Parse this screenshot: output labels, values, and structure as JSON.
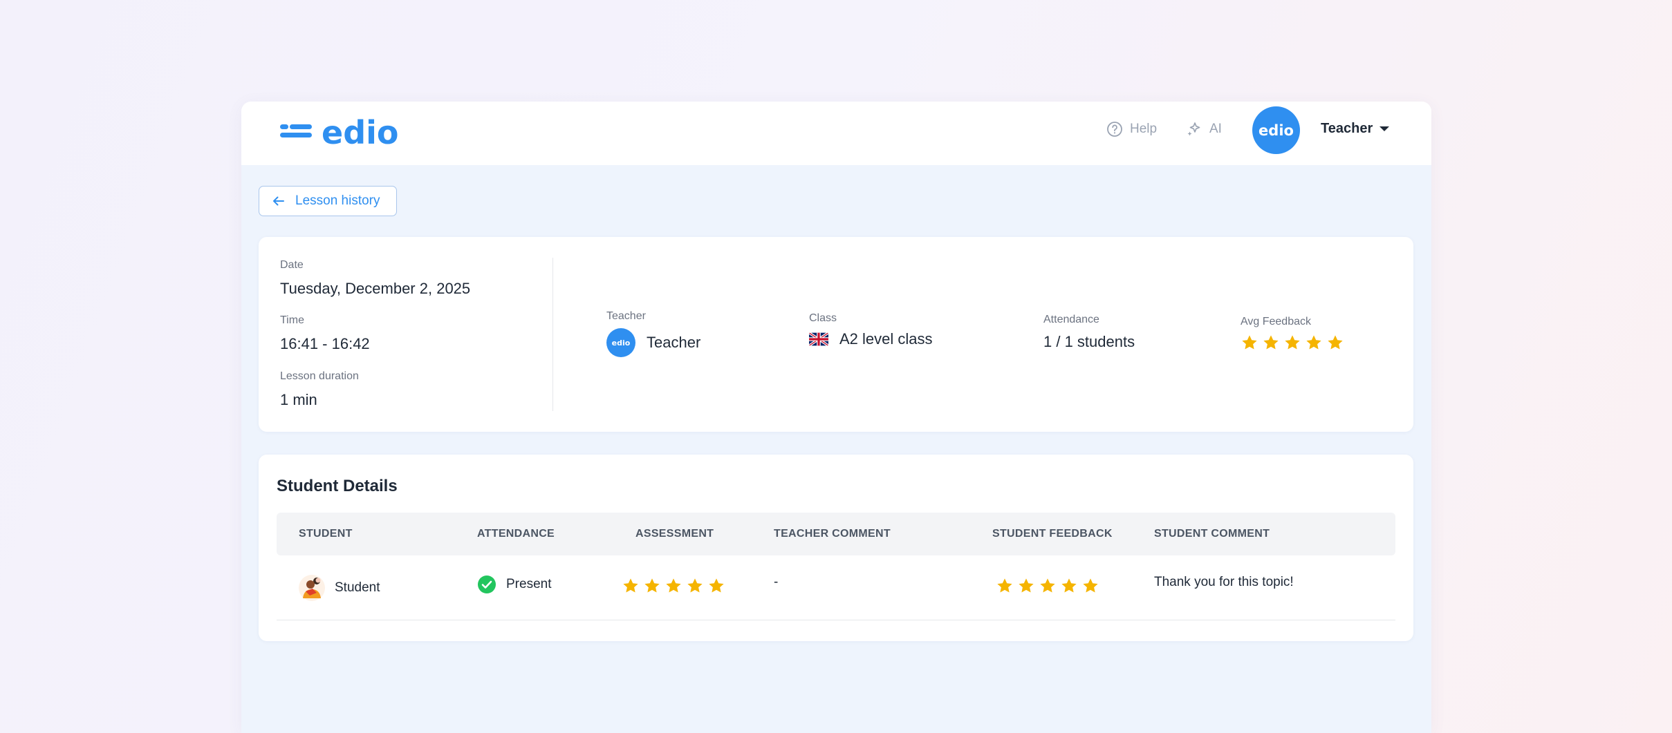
{
  "header": {
    "logo_text": "edio",
    "help_label": "Help",
    "ai_label": "AI",
    "avatar_text": "edio",
    "user_label": "Teacher"
  },
  "back_button": {
    "label": "Lesson history"
  },
  "summary": {
    "date_label": "Date",
    "date_value": "Tuesday, December 2, 2025",
    "time_label": "Time",
    "time_value": "16:41 - 16:42",
    "duration_label": "Lesson duration",
    "duration_value": "1 min",
    "teacher_label": "Teacher",
    "teacher_avatar_text": "edio",
    "teacher_value": "Teacher",
    "class_label": "Class",
    "class_value": "A2 level class",
    "class_flag": "uk-flag-icon",
    "attendance_label": "Attendance",
    "attendance_value": "1 / 1 students",
    "avg_feedback_label": "Avg Feedback",
    "avg_feedback_stars": 5
  },
  "students": {
    "title": "Student Details",
    "columns": [
      "STUDENT",
      "ATTENDANCE",
      "ASSESSMENT",
      "TEACHER COMMENT",
      "STUDENT FEEDBACK",
      "STUDENT COMMENT"
    ],
    "rows": [
      {
        "student": "Student",
        "attendance": "Present",
        "assessment_stars": 5,
        "teacher_comment": "-",
        "feedback_stars": 5,
        "student_comment": "Thank you for this topic!"
      }
    ]
  },
  "colors": {
    "brand": "#2f8ff0",
    "star": "#f5b400",
    "present": "#22c55e"
  }
}
